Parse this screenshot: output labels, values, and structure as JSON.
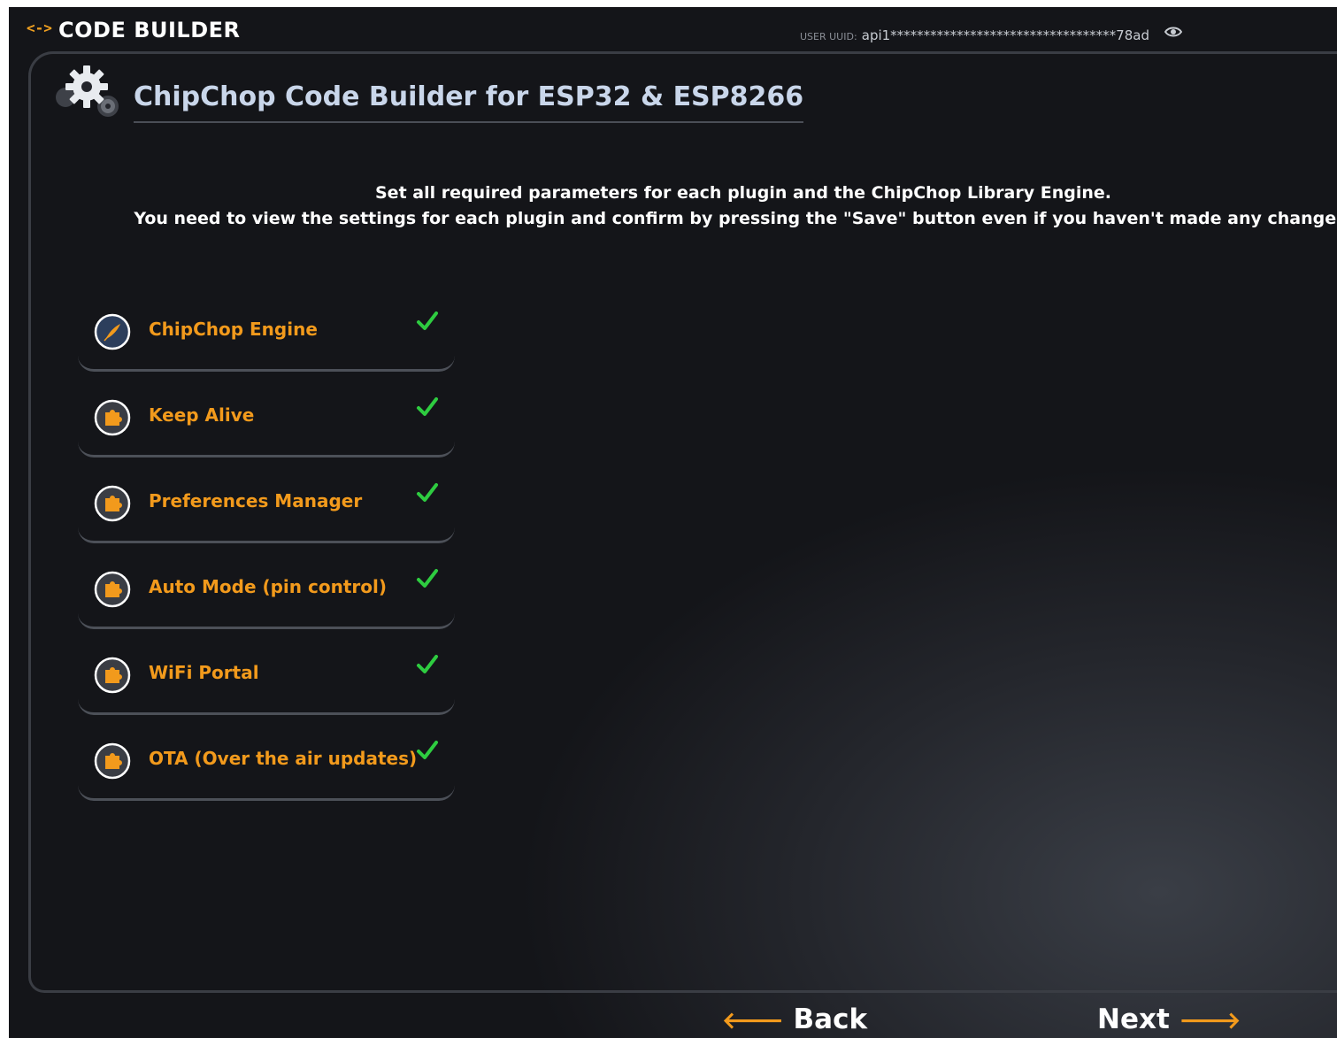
{
  "header": {
    "brand_icon": "<->",
    "title": "CODE BUILDER",
    "uuid_label": "USER UUID:",
    "uuid_value": "api1**********************************78ad",
    "eye_icon": "eye-icon"
  },
  "page": {
    "title": "ChipChop Code Builder for ESP32 & ESP8266",
    "icon": "gear-icon"
  },
  "instructions": [
    "Set all required parameters for each plugin and the ChipChop Library Engine.",
    "You need to view the settings for each plugin and confirm by pressing the \"Save\" button even if you haven't made any changes."
  ],
  "plugins": [
    {
      "label": "ChipChop Engine",
      "icon": "feather-icon",
      "status": "check"
    },
    {
      "label": "Keep Alive",
      "icon": "puzzle-icon",
      "status": "check"
    },
    {
      "label": "Preferences Manager",
      "icon": "puzzle-icon",
      "status": "check"
    },
    {
      "label": "Auto Mode (pin control)",
      "icon": "puzzle-icon",
      "status": "check"
    },
    {
      "label": "WiFi Portal",
      "icon": "puzzle-icon",
      "status": "check"
    },
    {
      "label": "OTA (Over the air updates)",
      "icon": "puzzle-icon",
      "status": "check"
    }
  ],
  "nav": {
    "back_arrow": "🡐",
    "back_label": "Back",
    "next_label": "Next",
    "next_arrow": "🡒"
  },
  "colors": {
    "accent": "#f29a1c",
    "check": "#2ecc40",
    "title": "#c9d6ea",
    "background": "#141519"
  }
}
